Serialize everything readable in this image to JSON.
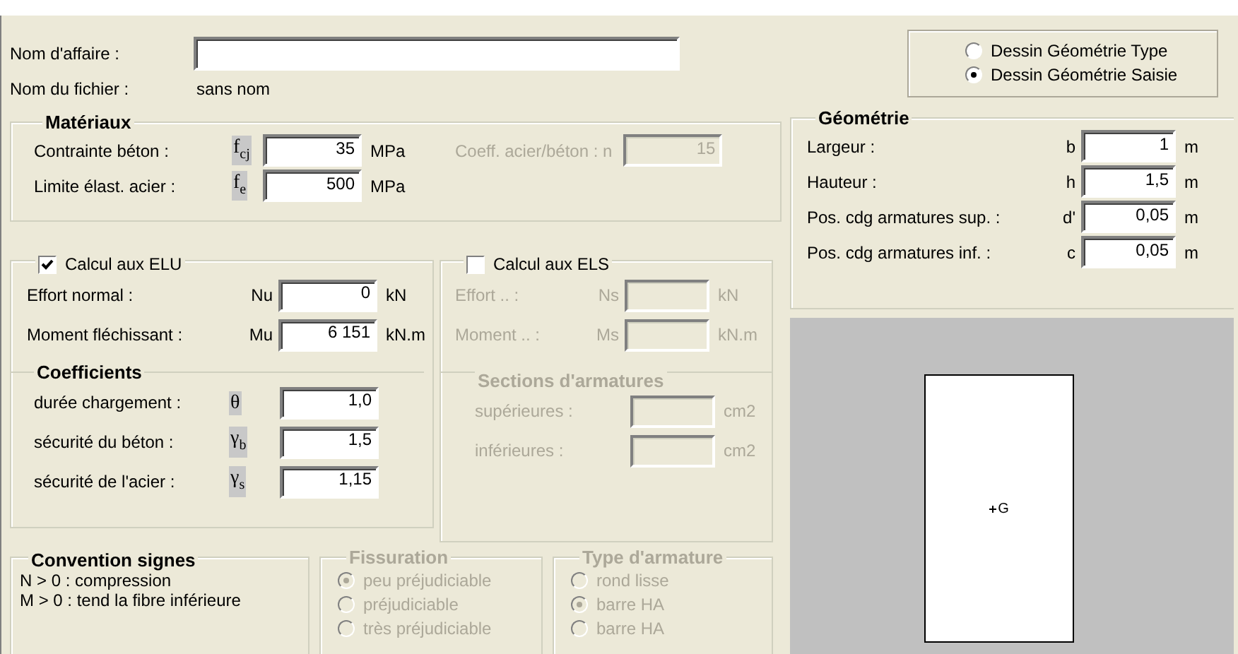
{
  "affaire": {
    "label": "Nom d'affaire :"
  },
  "fichier": {
    "label": "Nom du fichier :",
    "value": "sans nom"
  },
  "dessin": {
    "options": [
      {
        "label": "Dessin Géométrie Type",
        "selected": false
      },
      {
        "label": "Dessin Géométrie Saisie",
        "selected": true
      }
    ]
  },
  "materiaux": {
    "title": "Matériaux",
    "symbols_shaded": true,
    "rows": [
      {
        "label": "Contrainte béton :",
        "symbol": "f$_{cj}$",
        "value": "35",
        "unit": "MPa"
      },
      {
        "label": "Limite élast. acier :",
        "symbol": "f$_{e}$",
        "value": "500",
        "unit": "MPa"
      }
    ],
    "coeff": {
      "label": "Coeff. acier/béton : n",
      "value": "15",
      "disabled": true
    }
  },
  "elu": {
    "title": "Calcul aux ELU",
    "checked": true,
    "symbols_shaded": false,
    "rows": [
      {
        "label": "Effort normal :",
        "symbol": "Nu",
        "value": "0",
        "unit": "kN"
      },
      {
        "label": "Moment fléchissant :",
        "symbol": "Mu",
        "value": "6 151",
        "unit": "kN.m"
      }
    ]
  },
  "coefficients": {
    "title": "Coefficients",
    "symbols_shaded": true,
    "rows": [
      {
        "label": "durée chargement :",
        "symbol": "θ",
        "value": "1,0"
      },
      {
        "label": "sécurité du béton :",
        "symbol": "γ$_{b}$",
        "value": "1,5"
      },
      {
        "label": "sécurité de l'acier :",
        "symbol": "γ$_{s}$",
        "value": "1,15"
      }
    ]
  },
  "els": {
    "title": "Calcul aux ELS",
    "checked": false,
    "disabled": true,
    "symbols_shaded": false,
    "rows": [
      {
        "label": "Effort .. :",
        "symbol": "Ns",
        "unit": "kN"
      },
      {
        "label": "Moment .. :",
        "symbol": "Ms",
        "unit": "kN.m"
      }
    ]
  },
  "sections": {
    "title": "Sections d'armatures",
    "disabled": true,
    "rows": [
      {
        "label": "supérieures :",
        "unit": "cm2"
      },
      {
        "label": "inférieures :",
        "unit": "cm2"
      }
    ]
  },
  "geometrie": {
    "title": "Géométrie",
    "symbols_shaded": false,
    "rows": [
      {
        "label": "Largeur :",
        "symbol": "b",
        "value": "1",
        "unit": "m"
      },
      {
        "label": "Hauteur :",
        "symbol": "h",
        "value": "1,5",
        "unit": "m"
      },
      {
        "label": "Pos. cdg armatures sup. :",
        "symbol": "d'",
        "value": "0,05",
        "unit": "m"
      },
      {
        "label": "Pos. cdg armatures inf. :",
        "symbol": "c",
        "value": "0,05",
        "unit": "m"
      }
    ]
  },
  "section_view": {
    "point_label": "G"
  },
  "convention": {
    "title": "Convention signes",
    "lines": [
      "N > 0 : compression",
      "M > 0 : tend la fibre inférieure"
    ]
  },
  "fissuration": {
    "title": "Fissuration",
    "disabled": true,
    "options": [
      {
        "label": "peu préjudiciable",
        "selected": true
      },
      {
        "label": "préjudiciable",
        "selected": false
      },
      {
        "label": "très préjudiciable",
        "selected": false
      }
    ]
  },
  "type_armature": {
    "title": "Type d'armature",
    "disabled": true,
    "options": [
      {
        "label": "rond lisse",
        "selected": false
      },
      {
        "label": "barre HA",
        "selected": true
      },
      {
        "label": "barre HA",
        "selected": false
      }
    ]
  }
}
